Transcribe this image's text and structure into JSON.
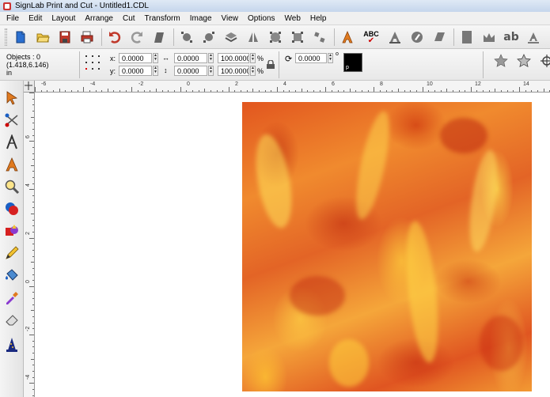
{
  "window": {
    "title": "SignLab Print and Cut - Untitled1.CDL"
  },
  "menu": [
    "File",
    "Edit",
    "Layout",
    "Arrange",
    "Cut",
    "Transform",
    "Image",
    "View",
    "Options",
    "Web",
    "Help"
  ],
  "toolbar": {
    "spellcheck_label": "ABC",
    "text_style_label": "ab"
  },
  "properties": {
    "objects_label": "Objects : 0",
    "cursor_pos": "(1.418,6.146)",
    "units": "in",
    "x_label": "x:",
    "x_value": "0.0000",
    "y_label": "y:",
    "y_value": "0.0000",
    "width_value": "0.0000",
    "height_value": "0.0000",
    "scale_w_value": "100.0000",
    "scale_h_value": "100.0000",
    "percent_sign": "%",
    "rotation_value": "0.0000",
    "degree_sign": "o",
    "swatch_label": "p"
  },
  "ruler": {
    "h_labels": [
      "-6",
      "-4",
      "-2",
      "0",
      "2",
      "4",
      "6",
      "8",
      "10",
      "12",
      "14"
    ],
    "v_labels": [
      "6",
      "4",
      "2",
      "0",
      "-2",
      "-4"
    ]
  },
  "colors": {
    "fire_dark": "#c8301a",
    "fire_mid": "#e8662a",
    "fire_light": "#ffd24a"
  }
}
